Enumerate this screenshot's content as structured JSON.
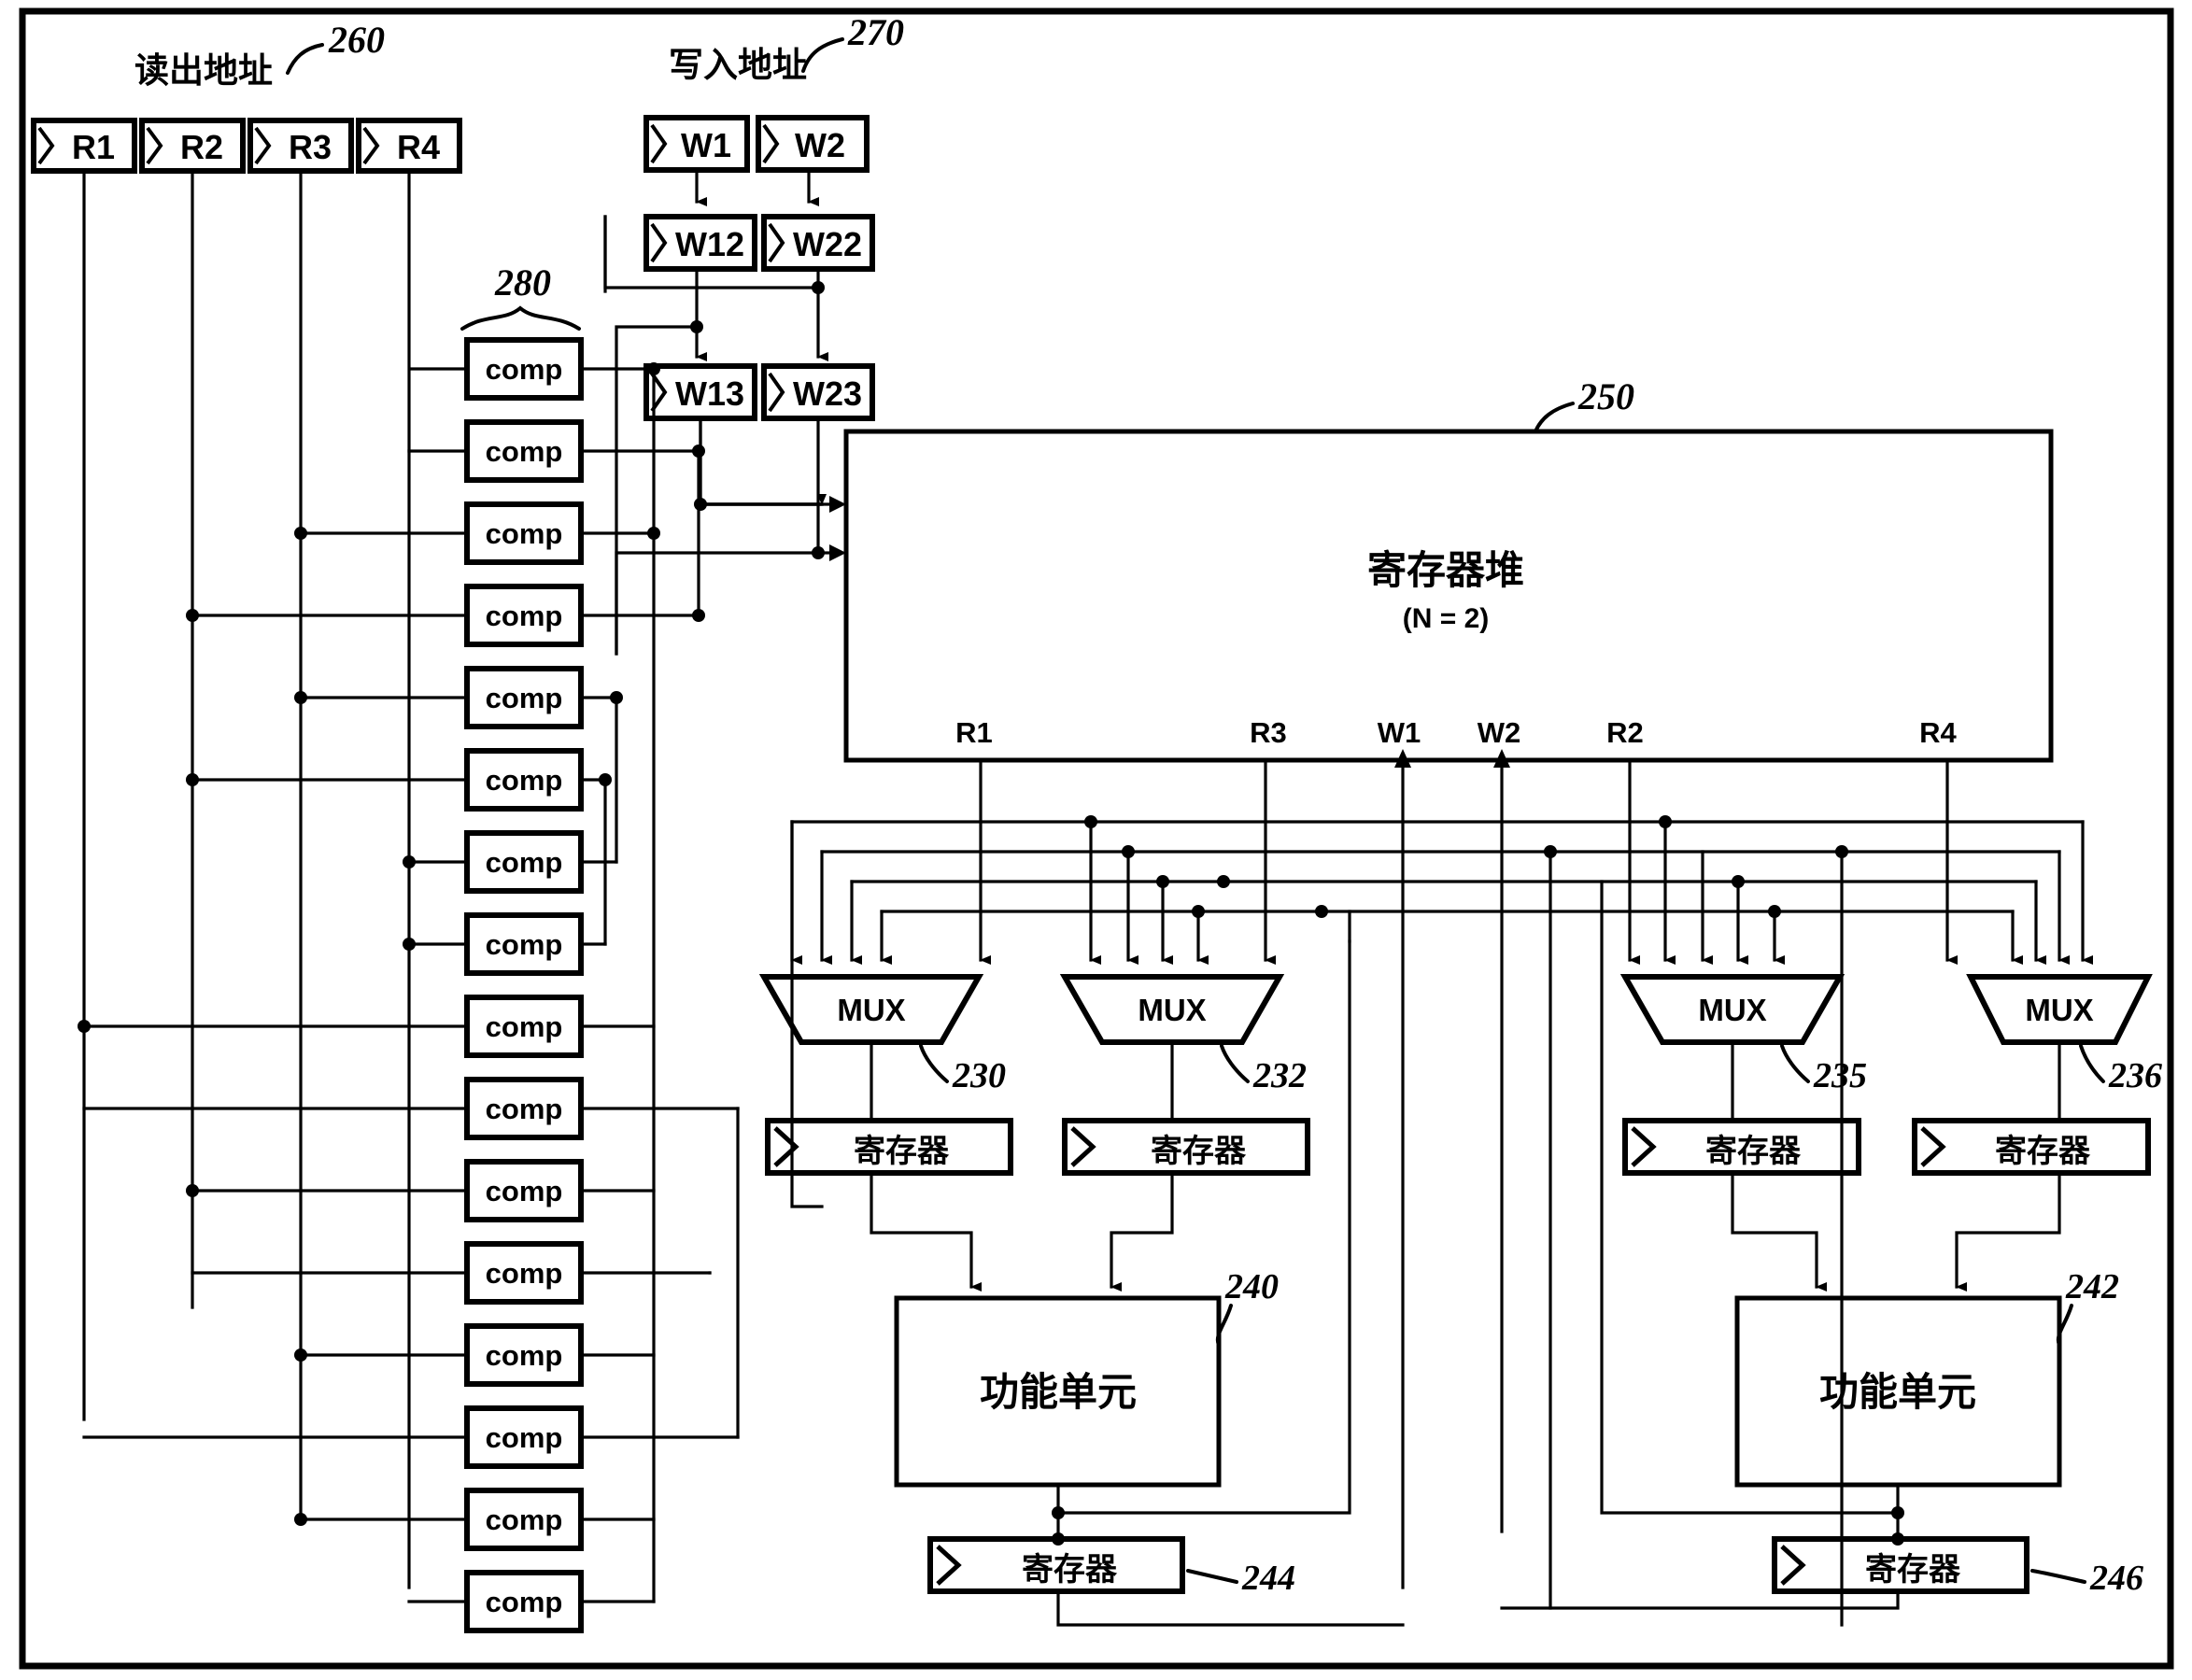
{
  "figure": {
    "type": "patent-block-diagram",
    "description": "Register file with bypass network block diagram",
    "background_color": "#ffffff",
    "line_color": "#000000"
  },
  "reference_numerals": {
    "read_address_group": "260",
    "write_address_group": "270",
    "register_file": "250",
    "comparator_bank": "280",
    "mux_a": "230",
    "mux_b": "232",
    "mux_c": "235",
    "mux_d": "236",
    "functional_unit_left": "240",
    "functional_unit_right": "242",
    "result_register_left": "244",
    "result_register_right": "246"
  },
  "read_address": {
    "label": "读出地址",
    "numeral": "260",
    "registers": [
      {
        "name": "R1"
      },
      {
        "name": "R2"
      },
      {
        "name": "R3"
      },
      {
        "name": "R4"
      }
    ]
  },
  "write_address": {
    "label": "写入地址",
    "numeral": "270",
    "stage1": [
      {
        "name": "W1"
      },
      {
        "name": "W2"
      }
    ],
    "stage2": [
      {
        "name": "W12"
      },
      {
        "name": "W22"
      }
    ],
    "stage3": [
      {
        "name": "W13"
      },
      {
        "name": "W23"
      }
    ]
  },
  "comparator_bank": {
    "numeral": "280",
    "comparator_label": "comp",
    "count": 16,
    "comparators": [
      {
        "label": "comp"
      },
      {
        "label": "comp"
      },
      {
        "label": "comp"
      },
      {
        "label": "comp"
      },
      {
        "label": "comp"
      },
      {
        "label": "comp"
      },
      {
        "label": "comp"
      },
      {
        "label": "comp"
      },
      {
        "label": "comp"
      },
      {
        "label": "comp"
      },
      {
        "label": "comp"
      },
      {
        "label": "comp"
      },
      {
        "label": "comp"
      },
      {
        "label": "comp"
      },
      {
        "label": "comp"
      },
      {
        "label": "comp"
      }
    ]
  },
  "register_file": {
    "title": "寄存器堆",
    "subtitle": "(N = 2)",
    "numeral": "250",
    "ports": [
      {
        "name": "R1",
        "direction": "out"
      },
      {
        "name": "R3",
        "direction": "out"
      },
      {
        "name": "W1",
        "direction": "in"
      },
      {
        "name": "W2",
        "direction": "in"
      },
      {
        "name": "R2",
        "direction": "out"
      },
      {
        "name": "R4",
        "direction": "out"
      }
    ]
  },
  "muxes": [
    {
      "label": "MUX",
      "numeral": "230",
      "inputs": 5
    },
    {
      "label": "MUX",
      "numeral": "232",
      "inputs": 5
    },
    {
      "label": "MUX",
      "numeral": "235",
      "inputs": 5
    },
    {
      "label": "MUX",
      "numeral": "236",
      "inputs": 5
    }
  ],
  "pipeline_registers": [
    {
      "label": "寄存器",
      "under_mux": "230"
    },
    {
      "label": "寄存器",
      "under_mux": "232"
    },
    {
      "label": "寄存器",
      "under_mux": "235"
    },
    {
      "label": "寄存器",
      "under_mux": "236"
    }
  ],
  "functional_units": [
    {
      "label": "功能单元",
      "numeral": "240"
    },
    {
      "label": "功能单元",
      "numeral": "242"
    }
  ],
  "result_registers": [
    {
      "label": "寄存器",
      "numeral": "244"
    },
    {
      "label": "寄存器",
      "numeral": "246"
    }
  ]
}
